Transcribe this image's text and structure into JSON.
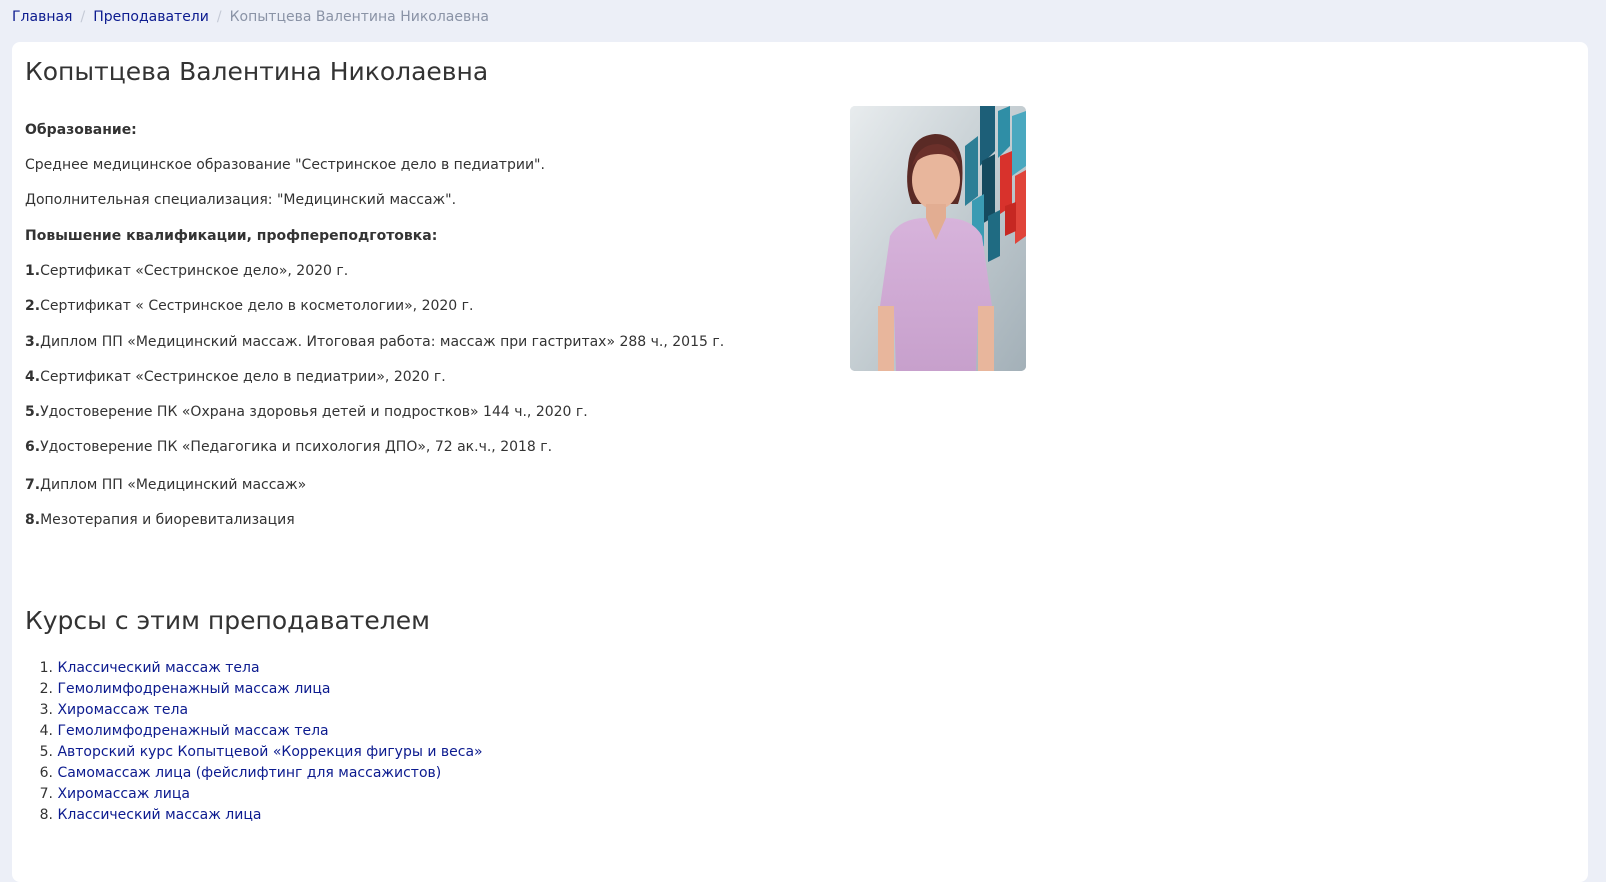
{
  "breadcrumb": {
    "home": "Главная",
    "teachers": "Преподаватели",
    "current": "Копытцева Валентина Николаевна",
    "separator": "/"
  },
  "profile": {
    "name": "Копытцева Валентина Николаевна",
    "education_label": "Образование:",
    "education_line1": "Среднее медицинское образование \"Сестринское дело в педиатрии\".",
    "education_line2": "Дополнительная специализация: \"Медицинский массаж\".",
    "qualification_label": "Повышение квалификации, профпереподготовка:",
    "qualifications": [
      {
        "num": "1.",
        "text": "Сертификат «Сестринское дело», 2020 г."
      },
      {
        "num": "2.",
        "text": "Сертификат « Сестринское дело в косметологии», 2020 г."
      },
      {
        "num": "3.",
        "text": "Диплом ПП «Медицинский массаж. Итоговая работа: массаж при гастритах» 288 ч., 2015 г."
      },
      {
        "num": "4.",
        "text": "Сертификат «Сестринское дело в педиатрии», 2020 г."
      },
      {
        "num": "5.",
        "text": "Удостоверение ПК «Охрана здоровья детей и подростков» 144 ч., 2020 г."
      },
      {
        "num": "6.",
        "text": "Удостоверение ПК «Педагогика и психология ДПО», 72 ак.ч., 2018 г."
      },
      {
        "num": "7.",
        "text": "Диплом ПП «Медицинский массаж»"
      },
      {
        "num": "8.",
        "text": "Мезотерапия и биоревитализация"
      }
    ]
  },
  "courses": {
    "title": "Курсы с этим преподавателем",
    "items": [
      {
        "num": "1.",
        "label": "Классический массаж тела"
      },
      {
        "num": "2.",
        "label": "Гемолимфодренажный массаж лица"
      },
      {
        "num": "3.",
        "label": "Хиромассаж тела"
      },
      {
        "num": "4.",
        "label": "Гемолимфодренажный массаж тела"
      },
      {
        "num": "5.",
        "label": "Авторский курс Копытцевой «Коррекция фигуры и веса»"
      },
      {
        "num": "6.",
        "label": "Самомассаж лица (фейслифтинг для массажистов)"
      },
      {
        "num": "7.",
        "label": "Хиромассаж лица"
      },
      {
        "num": "8.",
        "label": "Классический массаж лица"
      }
    ]
  },
  "colors": {
    "page_background": "#eceff7",
    "link": "#0c1b8f",
    "text": "#333333",
    "breadcrumb_current": "#8a93a6"
  }
}
